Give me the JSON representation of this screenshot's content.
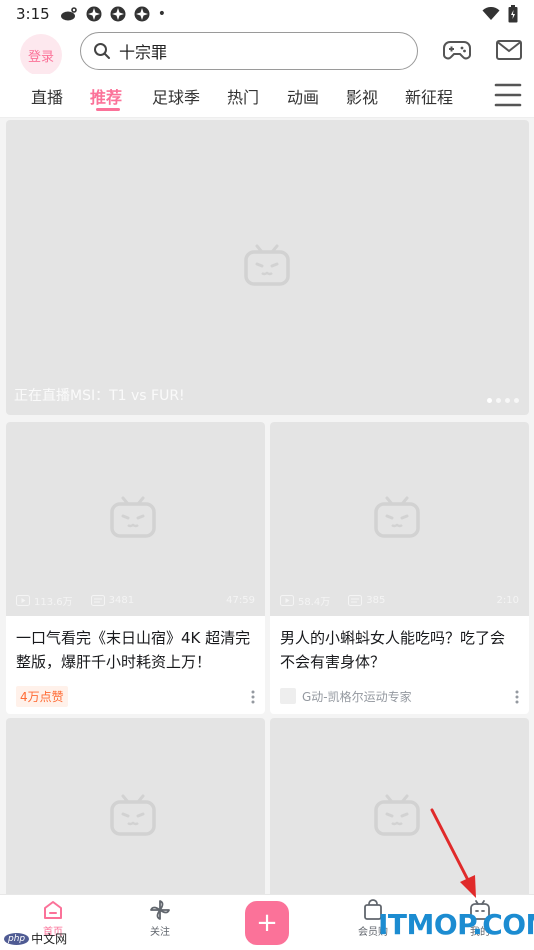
{
  "status_bar": {
    "time": "3:15",
    "notif_icons": [
      "weibo-icon",
      "pinwheel-icon",
      "pinwheel-icon",
      "pinwheel-icon"
    ],
    "dot": "•"
  },
  "header": {
    "login_label": "登录",
    "search_value": "十宗罪"
  },
  "tabs": [
    {
      "label": "直播"
    },
    {
      "label": "推荐",
      "active": true
    },
    {
      "label": "足球季"
    },
    {
      "label": "热门"
    },
    {
      "label": "动画"
    },
    {
      "label": "影视"
    },
    {
      "label": "新征程"
    }
  ],
  "banner": {
    "caption": "正在直播MSI：T1 vs FUR!"
  },
  "cards": [
    {
      "title": "一口气看完《末日山宿》4K 超清完整版，爆肝千小时耗资上万！",
      "badge": "4万点赞",
      "views": "113.6万",
      "danmaku": "3481",
      "duration": "47:59"
    },
    {
      "title": "男人的小蝌蚪女人能吃吗？吃了会不会有害身体？",
      "author": "G动-凯格尔运动专家",
      "views": "58.4万",
      "danmaku": "385",
      "duration": "2:10"
    }
  ],
  "bottom_nav": {
    "home": "首页",
    "follow": "关注",
    "publish": "+",
    "shop": "会员购",
    "mine": "我的"
  },
  "watermarks": {
    "left_badge": "php",
    "left_text": "中文网",
    "right_text": "ITMOP.COM"
  },
  "colors": {
    "accent": "#fb7299",
    "badge_orange": "#ff6a33",
    "watermark_blue": "#1c8cd1"
  }
}
